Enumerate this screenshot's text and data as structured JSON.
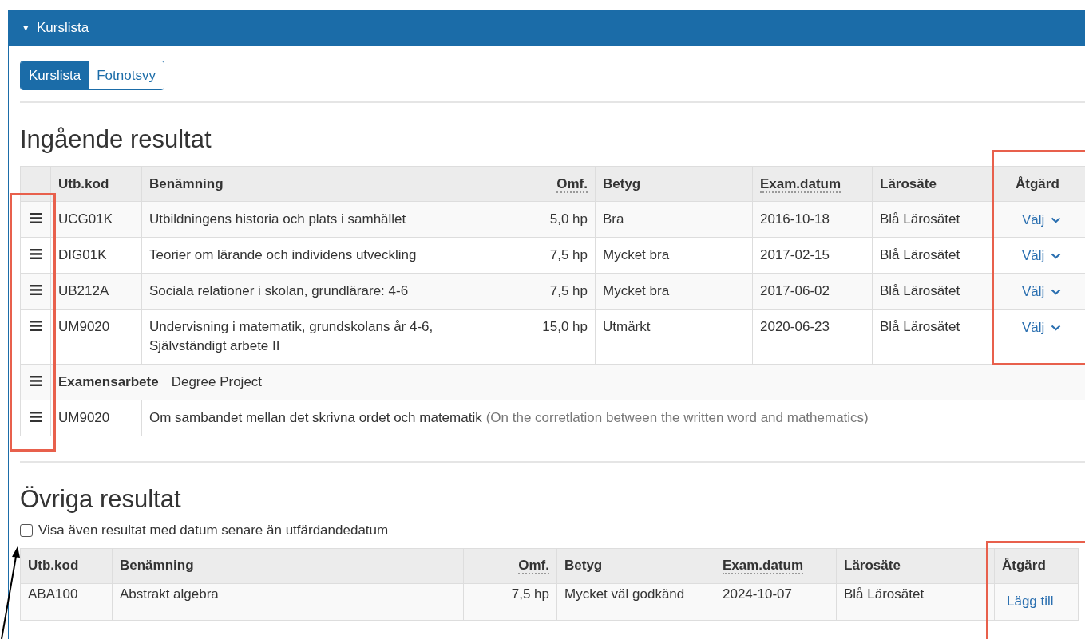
{
  "panel": {
    "caret": "▾",
    "title": "Kurslista"
  },
  "tabs": [
    {
      "label": "Kurslista",
      "selected": true
    },
    {
      "label": "Fotnotsvy",
      "selected": false
    }
  ],
  "included": {
    "heading": "Ingående resultat",
    "columns": [
      {
        "label": "Utb.kod",
        "dotted": false
      },
      {
        "label": "Benämning",
        "dotted": false
      },
      {
        "label": "Omf.",
        "dotted": true
      },
      {
        "label": "Betyg",
        "dotted": false
      },
      {
        "label": "Exam.datum",
        "dotted": true
      },
      {
        "label": "Lärosäte",
        "dotted": false
      },
      {
        "label": "Åtgärd",
        "dotted": false
      }
    ],
    "rows": [
      {
        "kind": "course",
        "code": "UCG01K",
        "name": "Utbildningens historia och plats i samhället",
        "credits": "5,0 hp",
        "grade": "Bra",
        "date": "2016-10-18",
        "institution": "Blå Lärosätet",
        "action": "Välj"
      },
      {
        "kind": "course",
        "code": "DIG01K",
        "name": "Teorier om lärande och individens utveckling",
        "credits": "7,5 hp",
        "grade": "Mycket bra",
        "date": "2017-02-15",
        "institution": "Blå Lärosätet",
        "action": "Välj"
      },
      {
        "kind": "course",
        "code": "UB212A",
        "name": "Sociala relationer i skolan, grundlärare: 4-6",
        "credits": "7,5 hp",
        "grade": "Mycket bra",
        "date": "2017-06-02",
        "institution": "Blå Lärosätet",
        "action": "Välj"
      },
      {
        "kind": "course",
        "code": "UM9020",
        "name": "Undervisning i matematik, grundskolans år 4-6, Självständigt arbete II",
        "credits": "15,0 hp",
        "grade": "Utmärkt",
        "date": "2020-06-23",
        "institution": "Blå Lärosätet",
        "action": "Välj"
      },
      {
        "kind": "group",
        "label": "Examensarbete",
        "label_en": "Degree Project"
      },
      {
        "kind": "thesis",
        "code": "UM9020",
        "title": "Om sambandet mellan det skrivna ordet och matematik",
        "translation": "(On the corretlation between the written word and mathematics)"
      }
    ]
  },
  "other": {
    "heading": "Övriga resultat",
    "checkbox": {
      "label": "Visa även resultat med datum senare än utfärdandedatum",
      "checked": false
    },
    "columns": [
      {
        "label": "Utb.kod",
        "dotted": false
      },
      {
        "label": "Benämning",
        "dotted": false
      },
      {
        "label": "Omf.",
        "dotted": true
      },
      {
        "label": "Betyg",
        "dotted": false
      },
      {
        "label": "Exam.datum",
        "dotted": true
      },
      {
        "label": "Lärosäte",
        "dotted": false
      },
      {
        "label": "Åtgärd",
        "dotted": false
      }
    ],
    "rows": [
      {
        "code": "ABA100",
        "name": "Abstrakt algebra",
        "credits": "7,5 hp",
        "grade": "Mycket väl godkänd",
        "date": "2024-10-07",
        "institution": "Blå Lärosätet",
        "action": "Lägg till"
      }
    ]
  }
}
